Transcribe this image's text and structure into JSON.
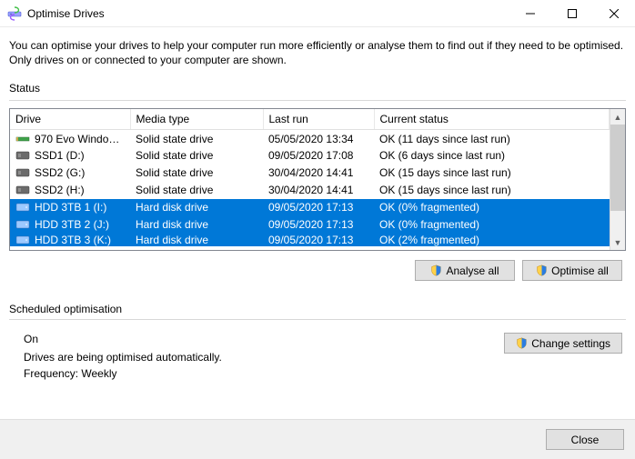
{
  "window": {
    "title": "Optimise Drives"
  },
  "intro": "You can optimise your drives to help your computer run more efficiently or analyse them to find out if they need to be optimised. Only drives on or connected to your computer are shown.",
  "status_label": "Status",
  "columns": {
    "drive": "Drive",
    "media": "Media type",
    "last_run": "Last run",
    "current": "Current status"
  },
  "rows": [
    {
      "icon": "nvme",
      "name": "970 Evo Windows (…",
      "media": "Solid state drive",
      "last_run": "05/05/2020 13:34",
      "status": "OK (11 days since last run)",
      "selected": false
    },
    {
      "icon": "ssd",
      "name": "SSD1 (D:)",
      "media": "Solid state drive",
      "last_run": "09/05/2020 17:08",
      "status": "OK (6 days since last run)",
      "selected": false
    },
    {
      "icon": "ssd",
      "name": "SSD2 (G:)",
      "media": "Solid state drive",
      "last_run": "30/04/2020 14:41",
      "status": "OK (15 days since last run)",
      "selected": false
    },
    {
      "icon": "ssd",
      "name": "SSD2 (H:)",
      "media": "Solid state drive",
      "last_run": "30/04/2020 14:41",
      "status": "OK (15 days since last run)",
      "selected": false
    },
    {
      "icon": "hdd",
      "name": "HDD 3TB 1 (I:)",
      "media": "Hard disk drive",
      "last_run": "09/05/2020 17:13",
      "status": "OK (0% fragmented)",
      "selected": true
    },
    {
      "icon": "hdd",
      "name": "HDD 3TB 2 (J:)",
      "media": "Hard disk drive",
      "last_run": "09/05/2020 17:13",
      "status": "OK (0% fragmented)",
      "selected": true
    },
    {
      "icon": "hdd",
      "name": "HDD 3TB 3 (K:)",
      "media": "Hard disk drive",
      "last_run": "09/05/2020 17:13",
      "status": "OK (2% fragmented)",
      "selected": true,
      "partial": true
    }
  ],
  "buttons": {
    "analyse": "Analyse all",
    "optimise": "Optimise all",
    "change": "Change settings",
    "close": "Close"
  },
  "scheduled": {
    "label": "Scheduled optimisation",
    "on": "On",
    "line1": "Drives are being optimised automatically.",
    "line2": "Frequency: Weekly"
  }
}
